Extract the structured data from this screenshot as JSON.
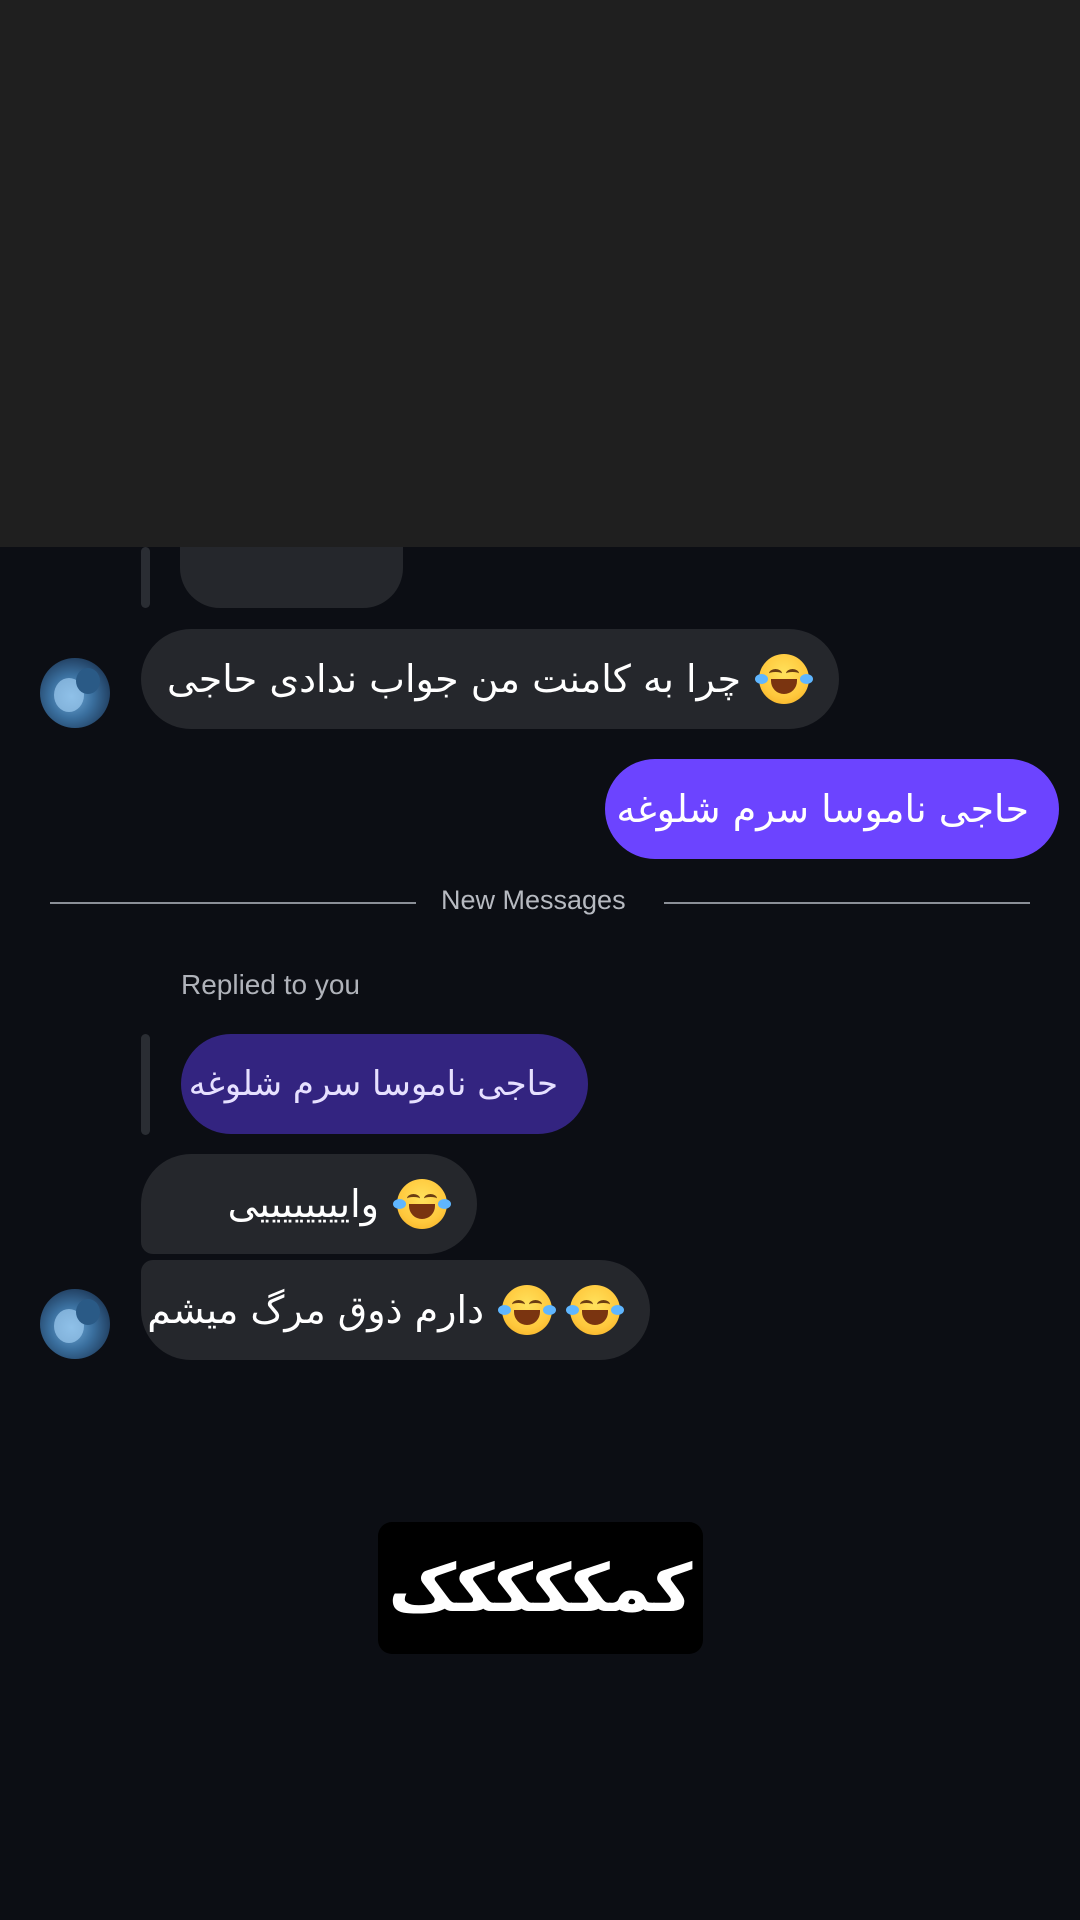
{
  "messages": {
    "first_incoming": "چرا به کامنت من جواب ندادی حاجی",
    "outgoing": "حاجی ناموسا سرم شلوغه",
    "new_messages_label": "New Messages",
    "replied_to_you": "Replied to you",
    "quoted_reply": "حاجی ناموسا سرم شلوغه",
    "second_incoming": "واییییییییی",
    "third_incoming": "دارم ذوق مرگ میشم"
  },
  "sticker": {
    "text": "کمککککک"
  },
  "icons": {
    "emoji": "face-with-tears-of-joy-icon",
    "avatar": "user-avatar"
  },
  "colors": {
    "background": "#0c0e14",
    "top_band": "#1f1f1f",
    "incoming_bubble": "#25272c",
    "outgoing_bubble": "#6c44ff",
    "quoted_bubble": "#332480"
  }
}
